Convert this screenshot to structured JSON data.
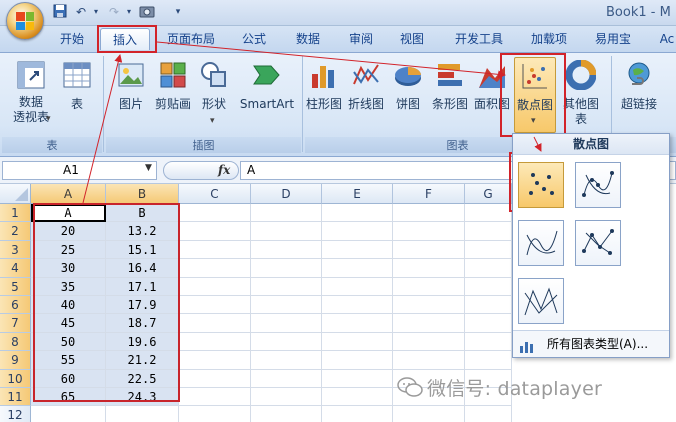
{
  "window": {
    "title": "Book1 - M"
  },
  "tabs": [
    "开始",
    "插入",
    "页面布局",
    "公式",
    "数据",
    "审阅",
    "视图",
    "开发工具",
    "加载项",
    "易用宝",
    "Ac"
  ],
  "ribbon": {
    "groups": {
      "table": "表",
      "illustrations": "插图",
      "charts": "图表"
    },
    "buttons": {
      "pivot": "数据\n透视表",
      "table": "表",
      "picture": "图片",
      "clipart": "剪贴画",
      "shapes": "形状",
      "smartart": "SmartArt",
      "column": "柱形图",
      "line": "折线图",
      "pie": "饼图",
      "bar": "条形图",
      "area": "面积图",
      "scatter": "散点图",
      "other": "其他图表",
      "hyperlink": "超链接"
    }
  },
  "formula_bar": {
    "name_box": "A1",
    "fx": "fx",
    "formula": "A"
  },
  "sheet": {
    "columns": [
      "A",
      "B",
      "C",
      "D",
      "E",
      "F",
      "G"
    ],
    "rows": [
      "1",
      "2",
      "3",
      "4",
      "5",
      "6",
      "7",
      "8",
      "9",
      "10",
      "11",
      "12"
    ],
    "data": [
      [
        "A",
        "B"
      ],
      [
        "20",
        "13.2"
      ],
      [
        "25",
        "15.1"
      ],
      [
        "30",
        "16.4"
      ],
      [
        "35",
        "17.1"
      ],
      [
        "40",
        "17.9"
      ],
      [
        "45",
        "18.7"
      ],
      [
        "50",
        "19.6"
      ],
      [
        "55",
        "21.2"
      ],
      [
        "60",
        "22.5"
      ],
      [
        "65",
        "24.3"
      ]
    ]
  },
  "dropdown": {
    "header": "散点图",
    "footer": "所有图表类型(A)..."
  },
  "watermark": "微信号: dataplayer",
  "colors": {
    "highlight": "#d2232a",
    "ribbon_bg": "#dbe7f7"
  }
}
